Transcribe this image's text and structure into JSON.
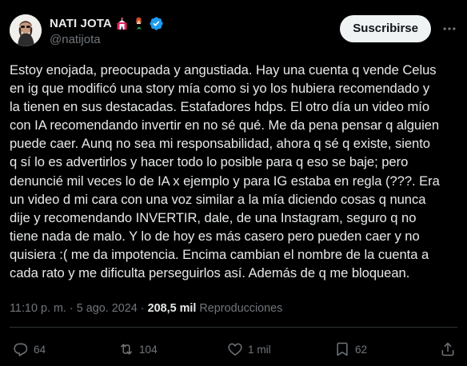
{
  "author": {
    "display_name": "NATI JOTA",
    "handle": "@natijota",
    "verified": true,
    "emojis": [
      "circus-tent",
      "mermaid"
    ]
  },
  "subscribe_label": "Suscribirse",
  "tweet_text": "Estoy enojada, preocupada y angustiada. Hay una cuenta q vende Celus\nen ig que modificó una story mía como si yo los hubiera recomendado y\nla tienen en sus destacadas. Estafadores hdps. El otro día un video mío\ncon IA recomendando invertir en no sé qué. Me da pena pensar q alguien\npuede caer. Aunq no sea mi responsabilidad, ahora q sé q existe, siento\nq sí lo es advertirlos y hacer todo lo posible para q eso se baje; pero\ndenuncié mil veces lo de IA x ejemplo y para IG estaba en regla (???. Era\nun video d mi cara con una voz similar a la mía diciendo cosas q nunca\ndije y recomendando INVERTIR, dale, de una Instagram, seguro q no\ntiene nada de malo. Y lo de hoy es más casero pero pueden caer y no\nquisiera :( me da impotencia. Encima cambian el nombre de la cuenta a\ncada rato y me dificulta perseguirlos así. Además de q me bloquean.",
  "meta": {
    "time": "11:10 p. m.",
    "separator": "·",
    "date": "5 ago. 2024",
    "views": "208,5 mil",
    "views_label": "Reproducciones"
  },
  "actions": {
    "replies": "64",
    "reposts": "104",
    "likes": "1 mil",
    "bookmarks": "62"
  },
  "colors": {
    "background": "#000000",
    "text": "#e7e9ea",
    "secondary": "#71767b",
    "verified_badge": "#1d9bf0",
    "divider": "#2f3336"
  }
}
